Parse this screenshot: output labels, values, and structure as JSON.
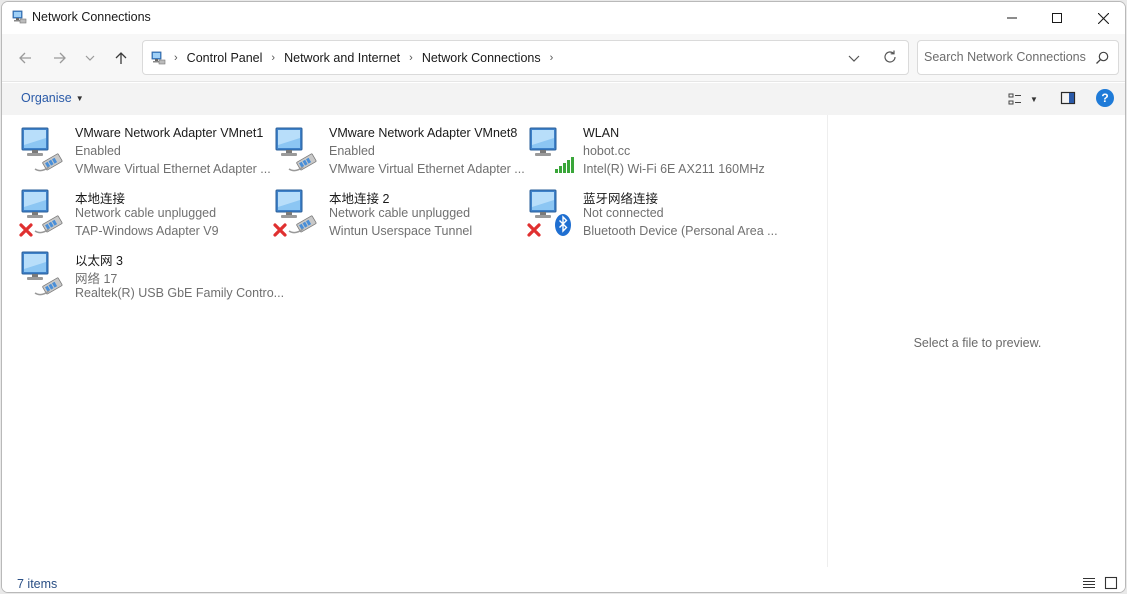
{
  "window": {
    "title": "Network Connections",
    "icon": "network-connections-icon"
  },
  "nav": {
    "breadcrumbs": [
      "Control Panel",
      "Network and Internet",
      "Network Connections"
    ],
    "search_placeholder": "Search Network Connections"
  },
  "toolbar": {
    "organise_label": "Organise",
    "help_label": "?"
  },
  "connections": [
    {
      "name": "VMware Network Adapter VMnet1",
      "status": "Enabled",
      "device": "VMware Virtual Ethernet Adapter ...",
      "type": "ethernet",
      "state": "ok"
    },
    {
      "name": "VMware Network Adapter VMnet8",
      "status": "Enabled",
      "device": "VMware Virtual Ethernet Adapter ...",
      "type": "ethernet",
      "state": "ok"
    },
    {
      "name": "WLAN",
      "status": "hobot.cc",
      "device": "Intel(R) Wi-Fi 6E AX211 160MHz",
      "type": "wifi",
      "state": "ok"
    },
    {
      "name": "本地连接",
      "status": "Network cable unplugged",
      "device": "TAP-Windows Adapter V9",
      "type": "ethernet",
      "state": "error"
    },
    {
      "name": "本地连接 2",
      "status": "Network cable unplugged",
      "device": "Wintun Userspace Tunnel",
      "type": "ethernet",
      "state": "error"
    },
    {
      "name": "蓝牙网络连接",
      "status": "Not connected",
      "device": "Bluetooth Device (Personal Area ...",
      "type": "bluetooth",
      "state": "error"
    },
    {
      "name": "以太网 3",
      "status": "网络 17",
      "device": "Realtek(R) USB GbE Family Contro...",
      "type": "ethernet",
      "state": "ok"
    }
  ],
  "preview": {
    "message": "Select a file to preview."
  },
  "status_bar": {
    "item_count": "7 items"
  },
  "colors": {
    "accent": "#1f7bd8",
    "link": "#2a5aa8",
    "error": "#e03030"
  }
}
